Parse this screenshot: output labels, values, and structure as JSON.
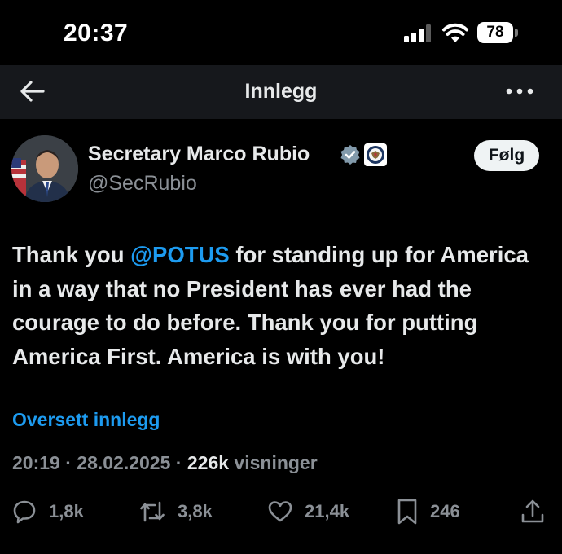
{
  "status_bar": {
    "time": "20:37",
    "battery": "78",
    "icons": [
      "cellular-signal-icon",
      "wifi-icon",
      "battery-icon"
    ]
  },
  "nav": {
    "title": "Innlegg",
    "back_icon": "arrow-left-icon",
    "more_icon": "more-horizontal-icon"
  },
  "author": {
    "name": "Secretary Marco Rubio",
    "handle": "@SecRubio",
    "follow_label": "Følg",
    "verified_color": "#829aab"
  },
  "post": {
    "text_before": "Thank you ",
    "mention": "@POTUS",
    "text_after": " for standing up for America in a way that no President has ever had the courage to do before. Thank you for putting America First. America is with you!",
    "translate_label": "Oversett innlegg"
  },
  "meta": {
    "time": "20:19",
    "separator": "·",
    "date": "28.02.2025",
    "views_count": "226k",
    "views_label": "visninger"
  },
  "actions": {
    "replies": "1,8k",
    "reposts": "3,8k",
    "likes": "21,4k",
    "bookmarks": "246"
  },
  "colors": {
    "accent": "#1d9bf0",
    "secondary_text": "#8b9096",
    "nav_background": "#16181c"
  }
}
